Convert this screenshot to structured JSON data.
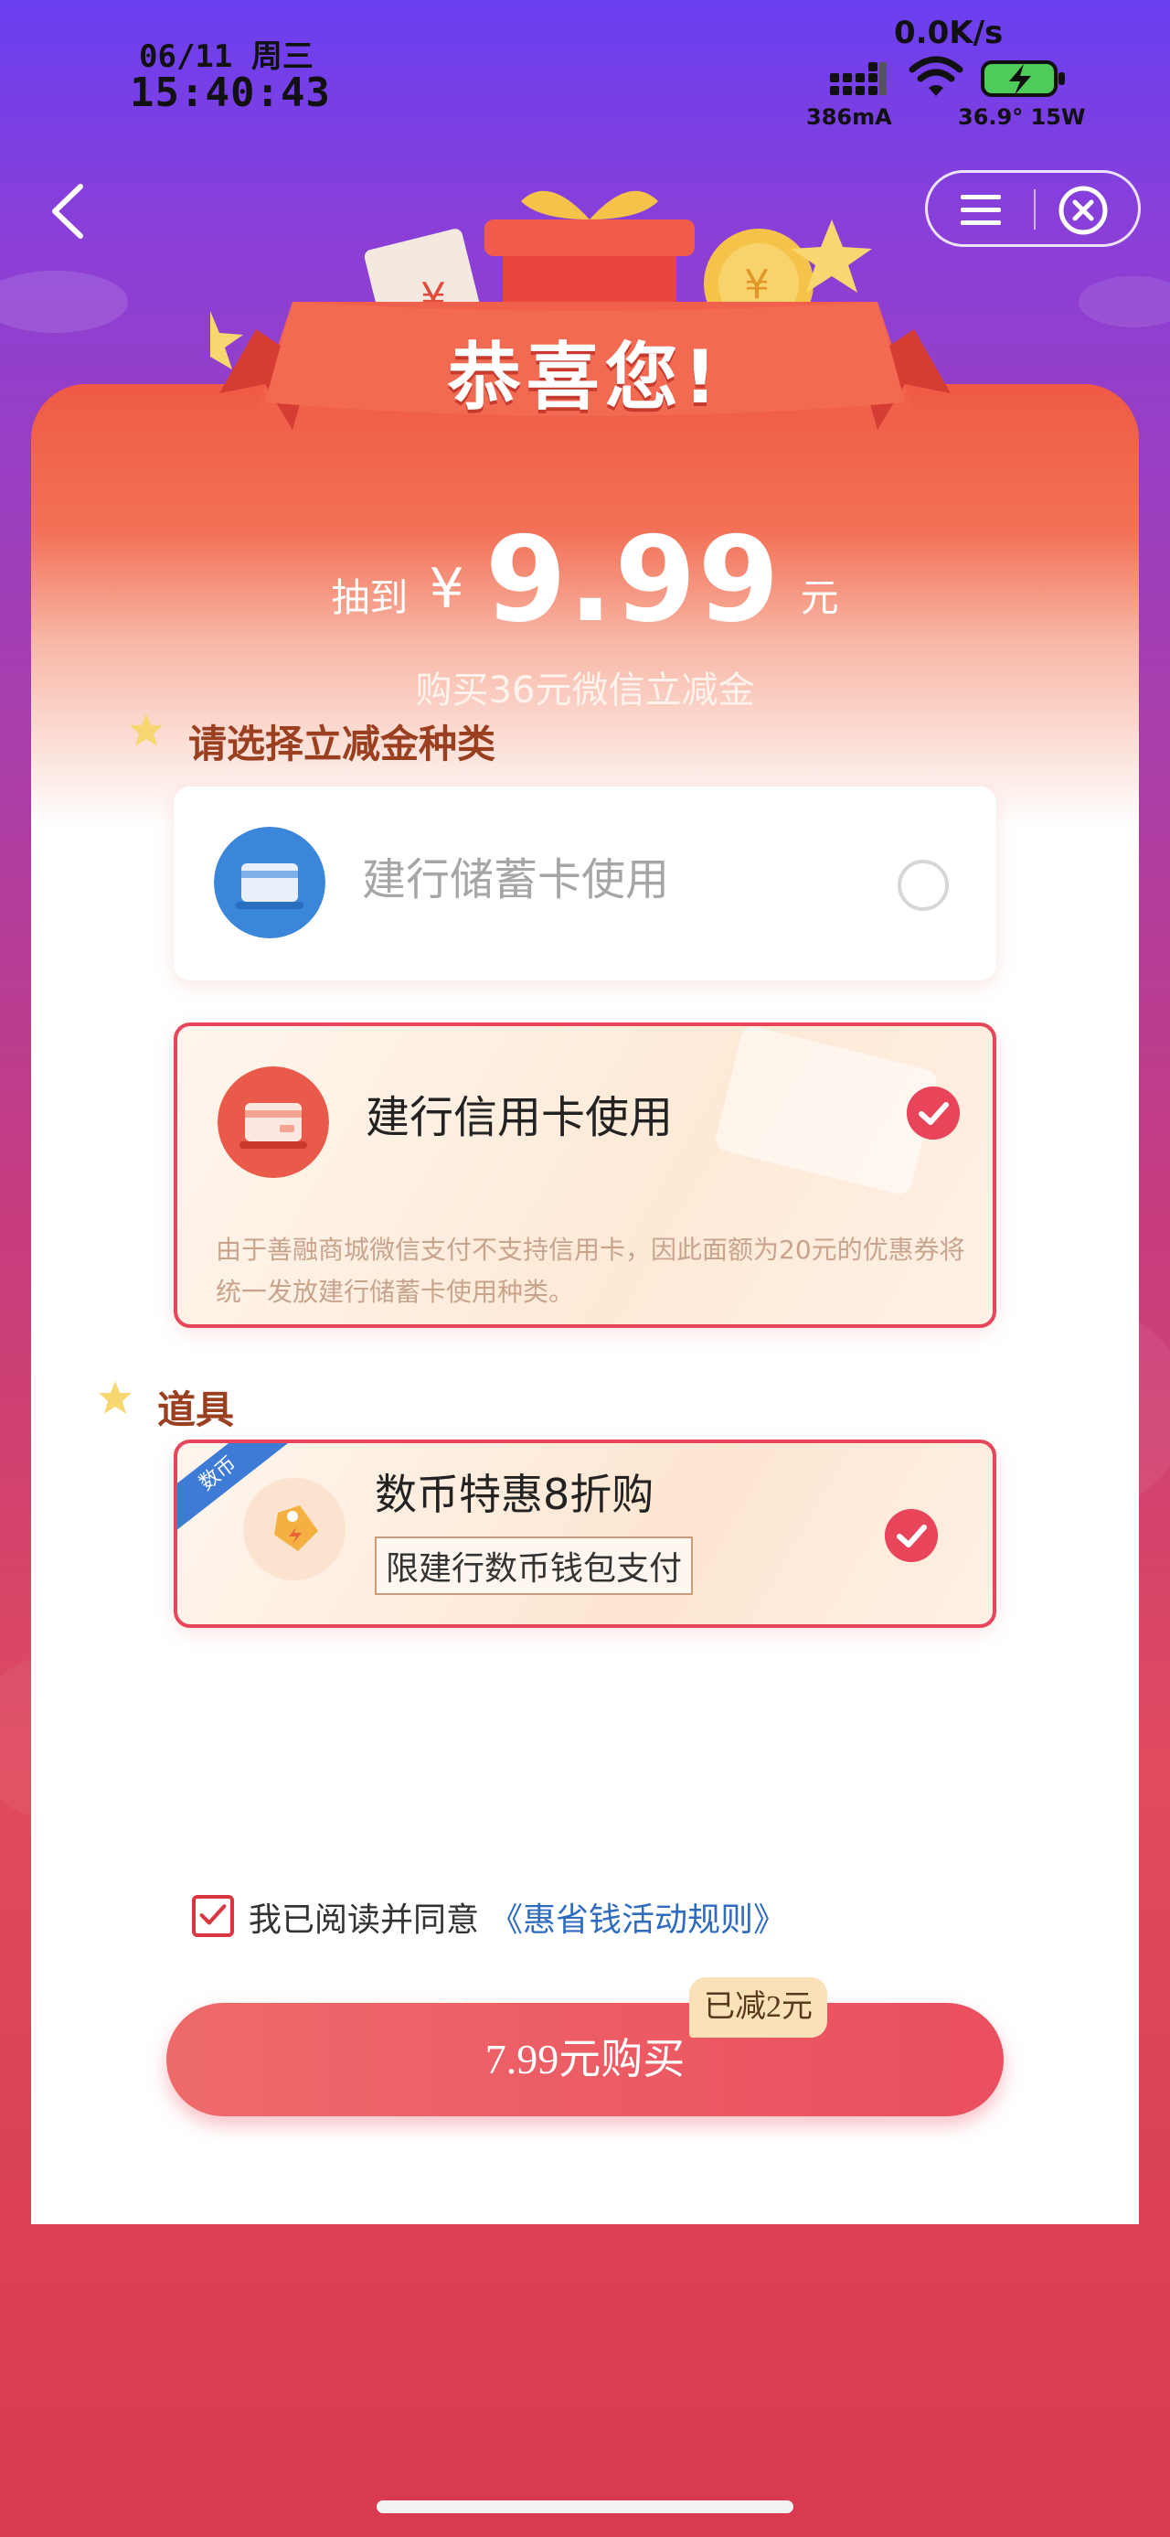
{
  "status_bar": {
    "date": "06/11 周三",
    "time": "15:40:43",
    "net_speed": "0.0K/s",
    "current": "386mA",
    "temp_power": "36.9° 15W"
  },
  "header": {
    "back_icon": "chevron-left-icon",
    "menu_icon": "menu-icon",
    "close_icon": "close-circle-icon"
  },
  "banner": {
    "title": "恭喜您!"
  },
  "prize": {
    "prefix": "抽到",
    "currency": "¥",
    "amount": "9.99",
    "unit": "元",
    "description": "购买36元微信立减金"
  },
  "section_type": {
    "title": "请选择立减金种类",
    "options": [
      {
        "label": "建行储蓄卡使用",
        "selected": false
      },
      {
        "label": "建行信用卡使用",
        "selected": true,
        "note": "由于善融商城微信支付不支持信用卡，因此面额为20元的优惠券将统一发放建行储蓄卡使用种类。"
      }
    ]
  },
  "section_tools": {
    "title": "道具",
    "item": {
      "corner_tag": "数币",
      "title": "数币特惠8折购",
      "badge": "限建行数币钱包支付",
      "selected": true
    }
  },
  "agreement": {
    "checked": true,
    "text": "我已阅读并同意",
    "link": "《惠省钱活动规则》"
  },
  "purchase": {
    "button_label": "7.99元购买",
    "discount_tag": "已减2元"
  },
  "colors": {
    "accent": "#e8445a",
    "link": "#2f6bbf",
    "section_title": "#9a4020"
  }
}
